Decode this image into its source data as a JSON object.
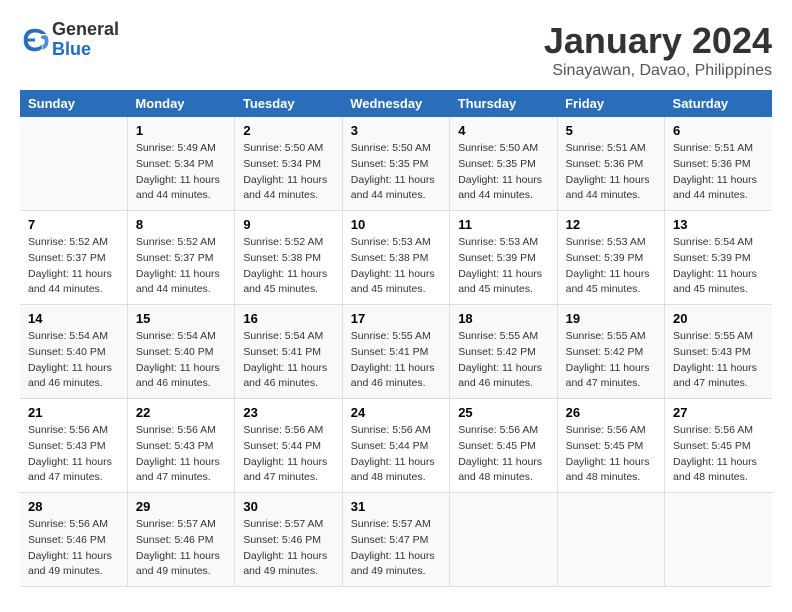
{
  "logo": {
    "general": "General",
    "blue": "Blue"
  },
  "title": "January 2024",
  "location": "Sinayawan, Davao, Philippines",
  "headers": [
    "Sunday",
    "Monday",
    "Tuesday",
    "Wednesday",
    "Thursday",
    "Friday",
    "Saturday"
  ],
  "weeks": [
    [
      {
        "day": "",
        "sunrise": "",
        "sunset": "",
        "daylight": ""
      },
      {
        "day": "1",
        "sunrise": "Sunrise: 5:49 AM",
        "sunset": "Sunset: 5:34 PM",
        "daylight": "Daylight: 11 hours and 44 minutes."
      },
      {
        "day": "2",
        "sunrise": "Sunrise: 5:50 AM",
        "sunset": "Sunset: 5:34 PM",
        "daylight": "Daylight: 11 hours and 44 minutes."
      },
      {
        "day": "3",
        "sunrise": "Sunrise: 5:50 AM",
        "sunset": "Sunset: 5:35 PM",
        "daylight": "Daylight: 11 hours and 44 minutes."
      },
      {
        "day": "4",
        "sunrise": "Sunrise: 5:50 AM",
        "sunset": "Sunset: 5:35 PM",
        "daylight": "Daylight: 11 hours and 44 minutes."
      },
      {
        "day": "5",
        "sunrise": "Sunrise: 5:51 AM",
        "sunset": "Sunset: 5:36 PM",
        "daylight": "Daylight: 11 hours and 44 minutes."
      },
      {
        "day": "6",
        "sunrise": "Sunrise: 5:51 AM",
        "sunset": "Sunset: 5:36 PM",
        "daylight": "Daylight: 11 hours and 44 minutes."
      }
    ],
    [
      {
        "day": "7",
        "sunrise": "Sunrise: 5:52 AM",
        "sunset": "Sunset: 5:37 PM",
        "daylight": "Daylight: 11 hours and 44 minutes."
      },
      {
        "day": "8",
        "sunrise": "Sunrise: 5:52 AM",
        "sunset": "Sunset: 5:37 PM",
        "daylight": "Daylight: 11 hours and 44 minutes."
      },
      {
        "day": "9",
        "sunrise": "Sunrise: 5:52 AM",
        "sunset": "Sunset: 5:38 PM",
        "daylight": "Daylight: 11 hours and 45 minutes."
      },
      {
        "day": "10",
        "sunrise": "Sunrise: 5:53 AM",
        "sunset": "Sunset: 5:38 PM",
        "daylight": "Daylight: 11 hours and 45 minutes."
      },
      {
        "day": "11",
        "sunrise": "Sunrise: 5:53 AM",
        "sunset": "Sunset: 5:39 PM",
        "daylight": "Daylight: 11 hours and 45 minutes."
      },
      {
        "day": "12",
        "sunrise": "Sunrise: 5:53 AM",
        "sunset": "Sunset: 5:39 PM",
        "daylight": "Daylight: 11 hours and 45 minutes."
      },
      {
        "day": "13",
        "sunrise": "Sunrise: 5:54 AM",
        "sunset": "Sunset: 5:39 PM",
        "daylight": "Daylight: 11 hours and 45 minutes."
      }
    ],
    [
      {
        "day": "14",
        "sunrise": "Sunrise: 5:54 AM",
        "sunset": "Sunset: 5:40 PM",
        "daylight": "Daylight: 11 hours and 46 minutes."
      },
      {
        "day": "15",
        "sunrise": "Sunrise: 5:54 AM",
        "sunset": "Sunset: 5:40 PM",
        "daylight": "Daylight: 11 hours and 46 minutes."
      },
      {
        "day": "16",
        "sunrise": "Sunrise: 5:54 AM",
        "sunset": "Sunset: 5:41 PM",
        "daylight": "Daylight: 11 hours and 46 minutes."
      },
      {
        "day": "17",
        "sunrise": "Sunrise: 5:55 AM",
        "sunset": "Sunset: 5:41 PM",
        "daylight": "Daylight: 11 hours and 46 minutes."
      },
      {
        "day": "18",
        "sunrise": "Sunrise: 5:55 AM",
        "sunset": "Sunset: 5:42 PM",
        "daylight": "Daylight: 11 hours and 46 minutes."
      },
      {
        "day": "19",
        "sunrise": "Sunrise: 5:55 AM",
        "sunset": "Sunset: 5:42 PM",
        "daylight": "Daylight: 11 hours and 47 minutes."
      },
      {
        "day": "20",
        "sunrise": "Sunrise: 5:55 AM",
        "sunset": "Sunset: 5:43 PM",
        "daylight": "Daylight: 11 hours and 47 minutes."
      }
    ],
    [
      {
        "day": "21",
        "sunrise": "Sunrise: 5:56 AM",
        "sunset": "Sunset: 5:43 PM",
        "daylight": "Daylight: 11 hours and 47 minutes."
      },
      {
        "day": "22",
        "sunrise": "Sunrise: 5:56 AM",
        "sunset": "Sunset: 5:43 PM",
        "daylight": "Daylight: 11 hours and 47 minutes."
      },
      {
        "day": "23",
        "sunrise": "Sunrise: 5:56 AM",
        "sunset": "Sunset: 5:44 PM",
        "daylight": "Daylight: 11 hours and 47 minutes."
      },
      {
        "day": "24",
        "sunrise": "Sunrise: 5:56 AM",
        "sunset": "Sunset: 5:44 PM",
        "daylight": "Daylight: 11 hours and 48 minutes."
      },
      {
        "day": "25",
        "sunrise": "Sunrise: 5:56 AM",
        "sunset": "Sunset: 5:45 PM",
        "daylight": "Daylight: 11 hours and 48 minutes."
      },
      {
        "day": "26",
        "sunrise": "Sunrise: 5:56 AM",
        "sunset": "Sunset: 5:45 PM",
        "daylight": "Daylight: 11 hours and 48 minutes."
      },
      {
        "day": "27",
        "sunrise": "Sunrise: 5:56 AM",
        "sunset": "Sunset: 5:45 PM",
        "daylight": "Daylight: 11 hours and 48 minutes."
      }
    ],
    [
      {
        "day": "28",
        "sunrise": "Sunrise: 5:56 AM",
        "sunset": "Sunset: 5:46 PM",
        "daylight": "Daylight: 11 hours and 49 minutes."
      },
      {
        "day": "29",
        "sunrise": "Sunrise: 5:57 AM",
        "sunset": "Sunset: 5:46 PM",
        "daylight": "Daylight: 11 hours and 49 minutes."
      },
      {
        "day": "30",
        "sunrise": "Sunrise: 5:57 AM",
        "sunset": "Sunset: 5:46 PM",
        "daylight": "Daylight: 11 hours and 49 minutes."
      },
      {
        "day": "31",
        "sunrise": "Sunrise: 5:57 AM",
        "sunset": "Sunset: 5:47 PM",
        "daylight": "Daylight: 11 hours and 49 minutes."
      },
      {
        "day": "",
        "sunrise": "",
        "sunset": "",
        "daylight": ""
      },
      {
        "day": "",
        "sunrise": "",
        "sunset": "",
        "daylight": ""
      },
      {
        "day": "",
        "sunrise": "",
        "sunset": "",
        "daylight": ""
      }
    ]
  ]
}
